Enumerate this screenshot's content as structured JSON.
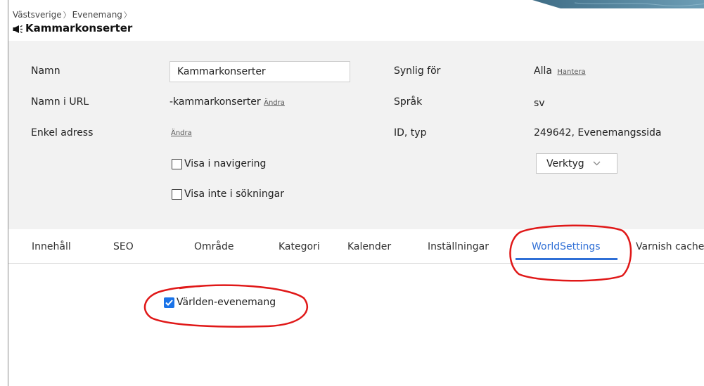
{
  "breadcrumb": {
    "item1": "Västsverige",
    "item2": "Evenemang"
  },
  "page": {
    "title": "Kammarkonserter",
    "icon": "megaphone-icon"
  },
  "properties": {
    "name_label": "Namn",
    "name_value": "Kammarkonserter",
    "url_label": "Namn i URL",
    "url_value": "-kammarkonserter",
    "url_change_link": "Ändra",
    "simple_address_label": "Enkel adress",
    "simple_address_change_link": "Ändra",
    "show_in_nav_label": "Visa i navigering",
    "hide_in_search_label": "Visa inte i sökningar",
    "visible_for_label": "Synlig för",
    "visible_for_value": "Alla",
    "manage_link": "Hantera",
    "language_label": "Språk",
    "language_value": "sv",
    "id_type_label": "ID, typ",
    "id_type_value": "249642, Evenemangssida",
    "tools_dropdown": "Verktyg"
  },
  "tabs": [
    {
      "label": "Innehåll"
    },
    {
      "label": "SEO"
    },
    {
      "label": "Område"
    },
    {
      "label": "Kategori"
    },
    {
      "label": "Kalender"
    },
    {
      "label": "Inställningar"
    },
    {
      "label": "WorldSettings",
      "active": true
    },
    {
      "label": "Varnish cache"
    }
  ],
  "world_settings": {
    "world_events_label": "Världen-evenemang",
    "world_events_checked": true
  },
  "colors": {
    "accent": "#2f6fd6",
    "checkbox": "#1a73e8",
    "annotation": "#e01818",
    "panel_bg": "#f2f2f2"
  }
}
